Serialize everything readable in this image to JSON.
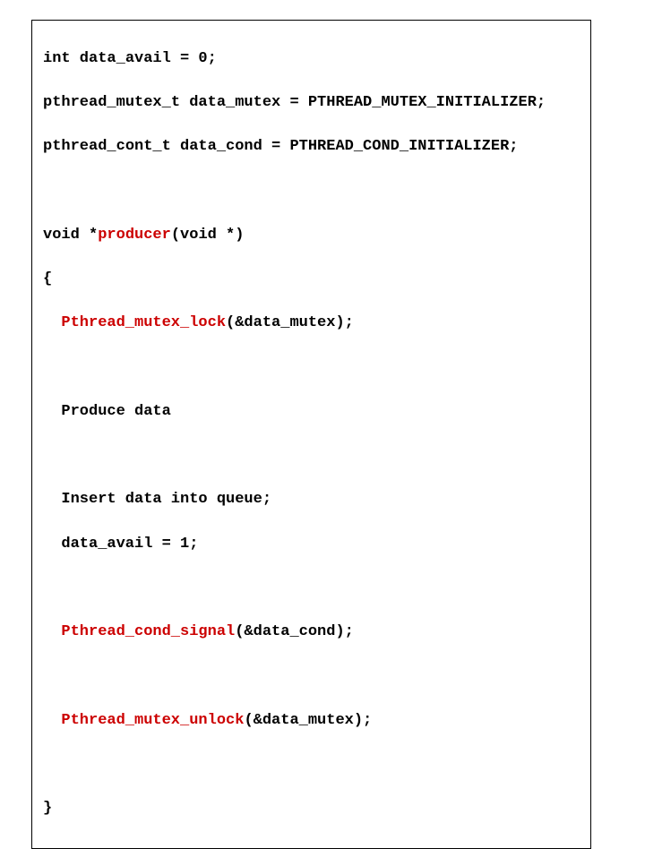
{
  "code": {
    "l1a": "int data_avail = 0;",
    "l2a": "pthread_mutex_t data_mutex = PTHREAD_MUTEX_INITIALIZER;",
    "l3a": "pthread_cont_t data_cond = PTHREAD_COND_INITIALIZER;",
    "l5a": "void *",
    "l5b": "producer",
    "l5c": "(void *)",
    "l6a": "{",
    "l7a": "Pthread_mutex_lock",
    "l7b": "(&data_mutex);",
    "l9a": "Produce data",
    "l11a": "Insert data into queue;",
    "l12a": "data_avail = 1;",
    "l14a": "Pthread_cond_signal",
    "l14b": "(&data_cond);",
    "l16a": "Pthread_mutex_unlock",
    "l16b": "(&data_mutex);",
    "l18a": "}"
  }
}
